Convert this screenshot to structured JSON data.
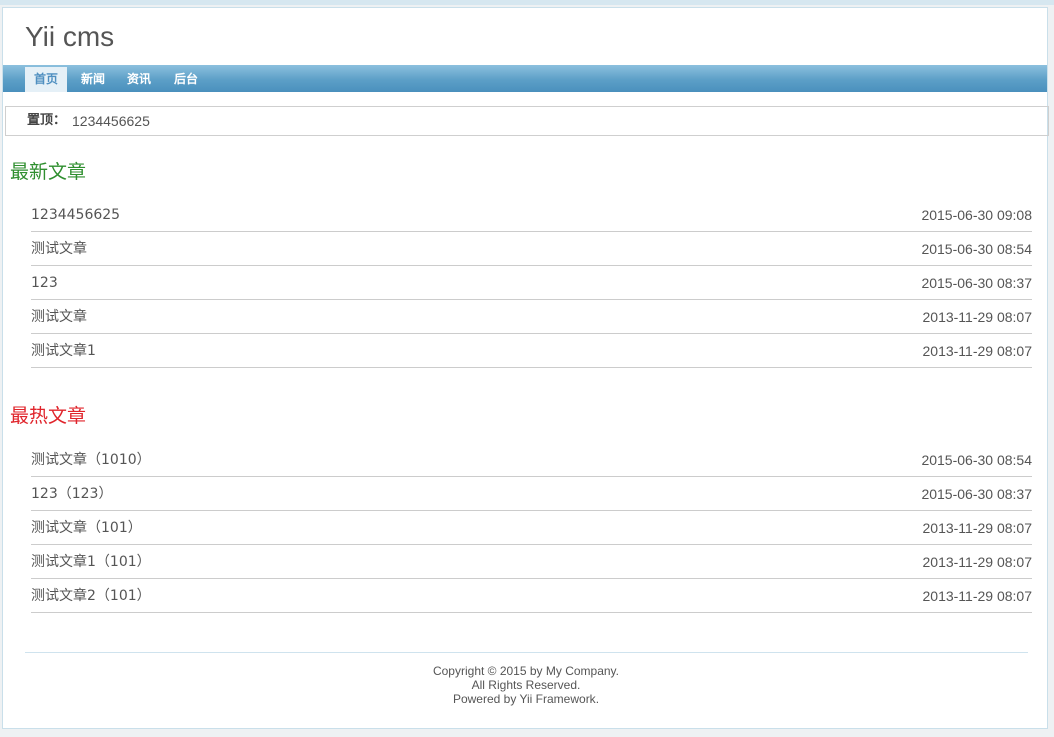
{
  "site": {
    "title": "Yii cms"
  },
  "nav": {
    "items": [
      {
        "label": "首页"
      },
      {
        "label": "新闻"
      },
      {
        "label": "资讯"
      },
      {
        "label": "后台"
      }
    ]
  },
  "pinned": {
    "label": "置顶：",
    "value": "1234456625"
  },
  "latest": {
    "heading": "最新文章",
    "items": [
      {
        "title": "1234456625",
        "date": "2015-06-30 09:08"
      },
      {
        "title": "测试文章",
        "date": "2015-06-30 08:54"
      },
      {
        "title": "123",
        "date": "2015-06-30 08:37"
      },
      {
        "title": "测试文章",
        "date": "2013-11-29 08:07"
      },
      {
        "title": "测试文章1",
        "date": "2013-11-29 08:07"
      }
    ]
  },
  "hot": {
    "heading": "最热文章",
    "items": [
      {
        "title": "测试文章（1010）",
        "date": "2015-06-30 08:54"
      },
      {
        "title": "123（123）",
        "date": "2015-06-30 08:37"
      },
      {
        "title": "测试文章（101）",
        "date": "2013-11-29 08:07"
      },
      {
        "title": "测试文章1（101）",
        "date": "2013-11-29 08:07"
      },
      {
        "title": "测试文章2（101）",
        "date": "2013-11-29 08:07"
      }
    ]
  },
  "footer": {
    "line1": "Copyright © 2015 by My Company.",
    "line2": "All Rights Reserved.",
    "line3_prefix": "Powered by ",
    "line3_link": "Yii Framework",
    "line3_suffix": "."
  },
  "colors": {
    "nav_bar": "#5c9fc7",
    "latest_heading": "#2f8f2f",
    "hot_heading": "#e0242b"
  }
}
